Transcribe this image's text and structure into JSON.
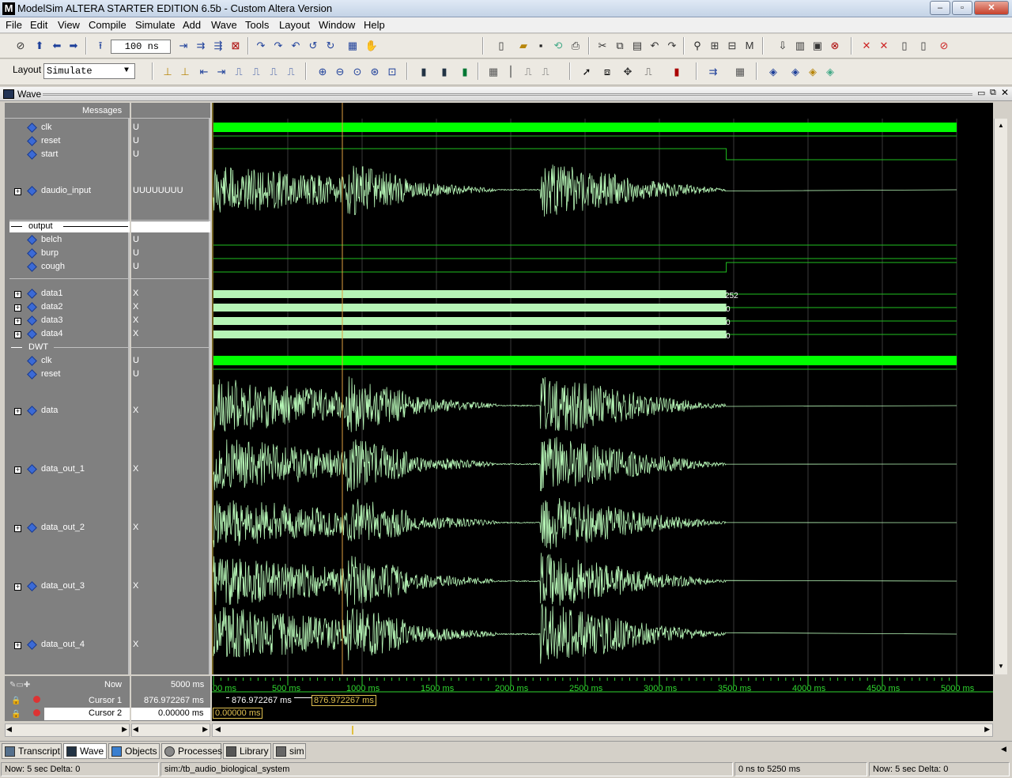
{
  "window": {
    "title": "ModelSim ALTERA STARTER EDITION 6.5b - Custom Altera Version"
  },
  "menu": [
    "File",
    "Edit",
    "View",
    "Compile",
    "Simulate",
    "Add",
    "Wave",
    "Tools",
    "Layout",
    "Window",
    "Help"
  ],
  "toolbar": {
    "run_length": "100 ns",
    "layout_label": "Layout",
    "layout_value": "Simulate"
  },
  "wave_window": {
    "title": "Wave",
    "messages_header": "Messages"
  },
  "signals": [
    {
      "name": "clk",
      "value": "U"
    },
    {
      "name": "reset",
      "value": "U"
    },
    {
      "name": "start",
      "value": "U"
    },
    {
      "name": "daudio_input",
      "value": "UUUUUUUU"
    },
    {
      "name": "belch",
      "value": "U"
    },
    {
      "name": "burp",
      "value": "U"
    },
    {
      "name": "cough",
      "value": "U"
    },
    {
      "name": "data1",
      "value": "X"
    },
    {
      "name": "data2",
      "value": "X"
    },
    {
      "name": "data3",
      "value": "X"
    },
    {
      "name": "data4",
      "value": "X"
    },
    {
      "name": "clk",
      "value": "U"
    },
    {
      "name": "reset",
      "value": "U"
    },
    {
      "name": "data",
      "value": "X"
    },
    {
      "name": "data_out_1",
      "value": "X"
    },
    {
      "name": "data_out_2",
      "value": "X"
    },
    {
      "name": "data_out_3",
      "value": "X"
    },
    {
      "name": "data_out_4",
      "value": "X"
    }
  ],
  "dividers": {
    "output": "output",
    "dwt": "DWT"
  },
  "bus_end_values": {
    "data1": "252",
    "data2": "0",
    "data3": "0",
    "data4": "0"
  },
  "time_axis": [
    "00 ms",
    "500 ms",
    "1000 ms",
    "1500 ms",
    "2000 ms",
    "2500 ms",
    "3000 ms",
    "3500 ms",
    "4000 ms",
    "4500 ms",
    "5000 ms"
  ],
  "cursors": {
    "now_label": "Now",
    "now_value": "5000 ms",
    "cursor1_label": "Cursor 1",
    "cursor1_value": "876.972267 ms",
    "cursor1_marker_left": "876.972267 ms",
    "cursor1_marker_right": "876.972267 ms",
    "cursor2_label": "Cursor 2",
    "cursor2_value": "0.00000 ms",
    "cursor2_marker": "0.00000 ms"
  },
  "tabs": [
    "Transcript",
    "Wave",
    "Objects",
    "Processes",
    "Library",
    "sim"
  ],
  "status": {
    "now": "Now: 5 sec  Delta: 0",
    "context": "sim:/tb_audio_biological_system",
    "range": "0 ns to 5250 ms",
    "now_right": "Now: 5 sec  Delta: 0"
  },
  "colors": {
    "wave_green": "#b6f5b6",
    "clock_green": "#00ff00",
    "cursor_yellow": "#f0c040",
    "axis_green": "#2fd62f"
  }
}
